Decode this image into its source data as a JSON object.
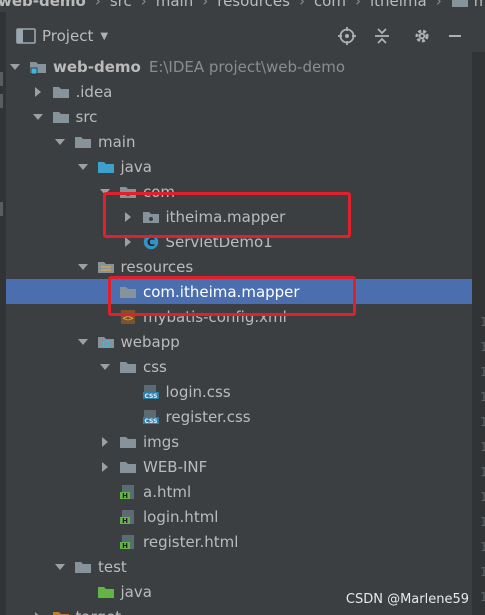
{
  "breadcrumb": [
    "web-demo",
    "src",
    "main",
    "resources",
    "com",
    "itheima",
    "mapper"
  ],
  "header": {
    "title": "Project",
    "actions": [
      "locate-icon",
      "collapse-all-icon",
      "gear-icon",
      "minimize-icon"
    ]
  },
  "tree": [
    {
      "label": "web-demo",
      "path": "E:\\IDEA project\\web-demo",
      "icon": "module-icon",
      "expand": "open",
      "bold": true
    },
    {
      "label": ".idea",
      "icon": "folder-icon",
      "expand": "closed"
    },
    {
      "label": "src",
      "icon": "folder-icon",
      "expand": "open"
    },
    {
      "label": "main",
      "icon": "folder-icon",
      "expand": "open"
    },
    {
      "label": "java",
      "icon": "source-folder-icon",
      "expand": "open"
    },
    {
      "label": "com",
      "icon": "package-icon",
      "expand": "open"
    },
    {
      "label": "itheima.mapper",
      "icon": "package-icon",
      "expand": "closed"
    },
    {
      "label": "ServletDemo1",
      "icon": "java-class-icon",
      "expand": "closed"
    },
    {
      "label": "resources",
      "icon": "resources-folder-icon",
      "expand": "open"
    },
    {
      "label": "com.itheima.mapper",
      "icon": "folder-icon",
      "expand": "none",
      "selected": true
    },
    {
      "label": "mybatis-config.xml",
      "icon": "xml-file-icon",
      "expand": "none"
    },
    {
      "label": "webapp",
      "icon": "web-folder-icon",
      "expand": "open"
    },
    {
      "label": "css",
      "icon": "folder-icon",
      "expand": "open"
    },
    {
      "label": "login.css",
      "icon": "css-file-icon",
      "expand": "none"
    },
    {
      "label": "register.css",
      "icon": "css-file-icon",
      "expand": "none"
    },
    {
      "label": "imgs",
      "icon": "folder-icon",
      "expand": "closed"
    },
    {
      "label": "WEB-INF",
      "icon": "folder-icon",
      "expand": "closed"
    },
    {
      "label": "a.html",
      "icon": "html-file-icon",
      "expand": "none"
    },
    {
      "label": "login.html",
      "icon": "html-file-icon",
      "expand": "none"
    },
    {
      "label": "register.html",
      "icon": "html-file-icon",
      "expand": "none"
    },
    {
      "label": "test",
      "icon": "folder-icon",
      "expand": "open"
    },
    {
      "label": "java",
      "icon": "test-source-folder-icon",
      "expand": "none"
    },
    {
      "label": "target",
      "icon": "excluded-folder-icon",
      "expand": "closed"
    }
  ],
  "colors": {
    "background": "#3c3f41",
    "selection": "#4b6eaf",
    "highlight_box": "#e0202a"
  },
  "watermark": "CSDN @Marlene59"
}
